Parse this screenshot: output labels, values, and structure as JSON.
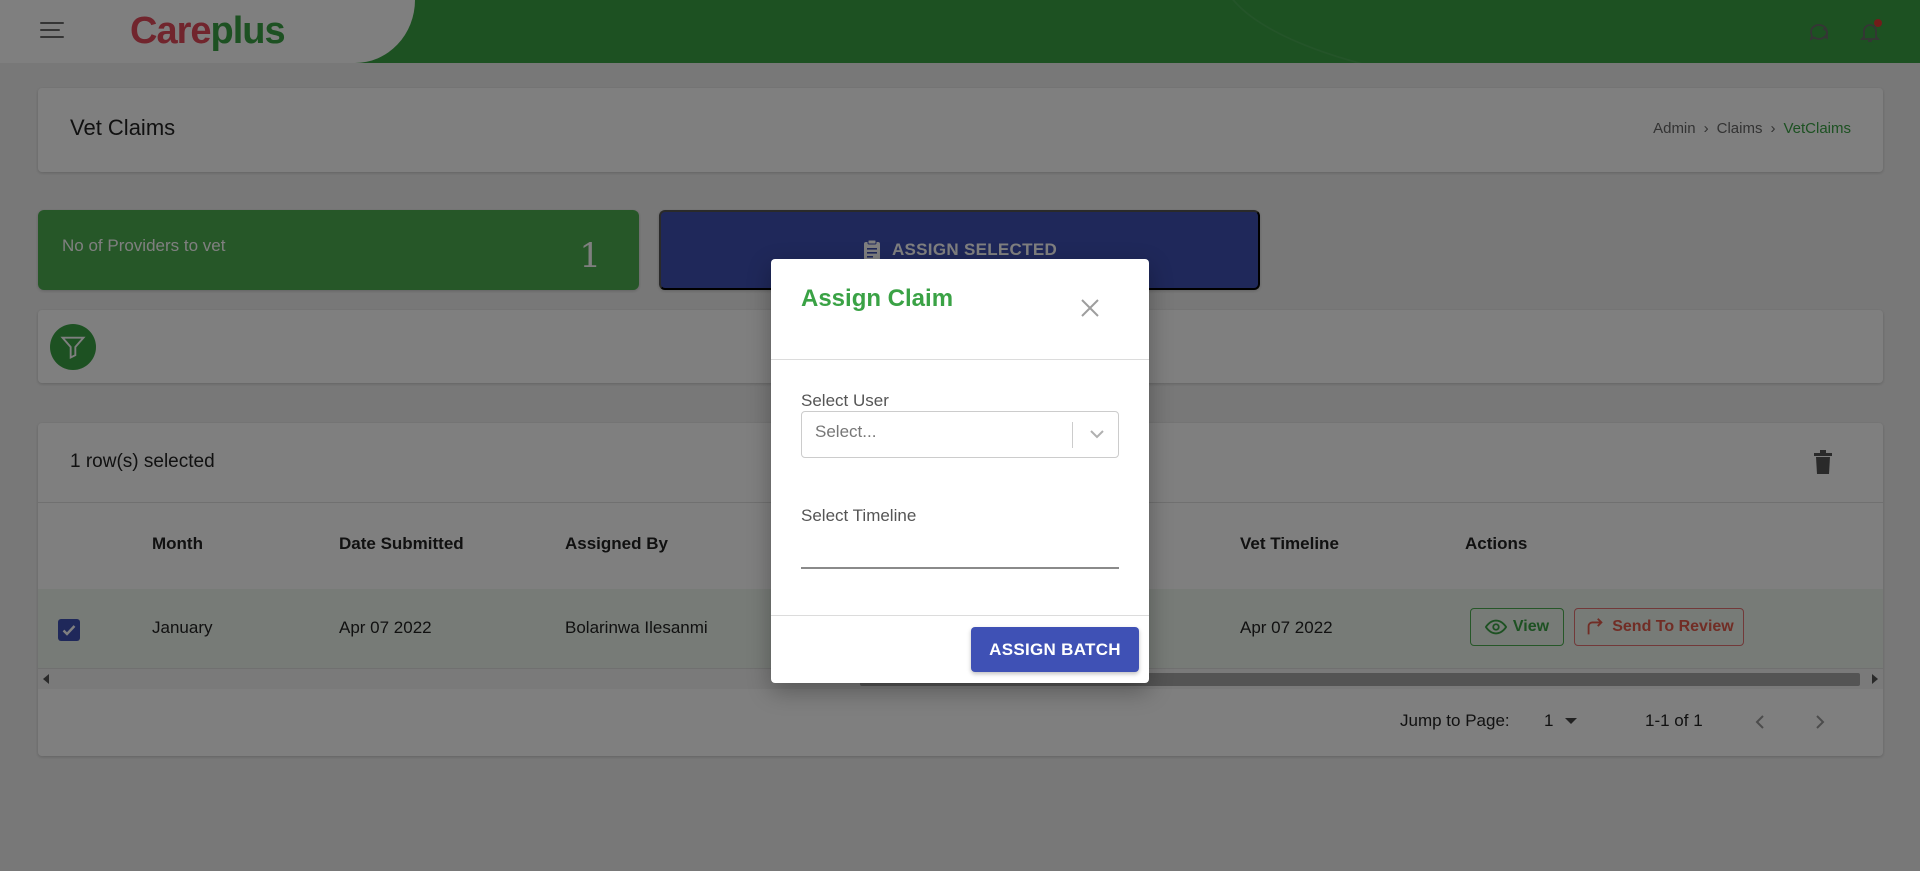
{
  "app": {
    "logo_part1": "Care",
    "logo_part2": "plus"
  },
  "header": {
    "title": "Vet Claims",
    "breadcrumb": [
      "Admin",
      "Claims",
      "VetClaims"
    ]
  },
  "stats": {
    "providers_label": "No of Providers to vet",
    "providers_value": "1",
    "assign_selected_label": "ASSIGN SELECTED"
  },
  "table": {
    "selection_text": "1 row(s) selected",
    "columns": [
      "Month",
      "Date Submitted",
      "Assigned By",
      "Vet Timeline",
      "Actions"
    ],
    "rows": [
      {
        "month": "January",
        "date_submitted": "Apr 07 2022",
        "assigned_by": "Bolarinwa Ilesanmi",
        "vet_timeline": "Apr 07 2022",
        "view_label": "View",
        "review_label": "Send To Review",
        "selected": true
      }
    ],
    "pagination": {
      "jump_label": "Jump to Page:",
      "current_page": "1",
      "range_text": "1-1 of 1"
    }
  },
  "modal": {
    "title": "Assign Claim",
    "select_user_label": "Select User",
    "select_user_placeholder": "Select...",
    "select_timeline_label": "Select Timeline",
    "select_timeline_value": "",
    "submit_label": "ASSIGN BATCH"
  },
  "colors": {
    "brand_green": "#3aa245",
    "primary_blue": "#3f51b5",
    "review_red": "#e25b4a",
    "logo_red": "#e24a5a"
  },
  "icons": {
    "menu": "hamburger-icon",
    "chat": "chat-icon",
    "notifications": "bell-icon",
    "assign": "clipboard-icon",
    "filter": "filter-icon",
    "delete": "trash-icon",
    "view": "eye-icon",
    "review": "reply-arrow-icon",
    "close": "close-icon",
    "dropdown": "chevron-down-icon"
  }
}
